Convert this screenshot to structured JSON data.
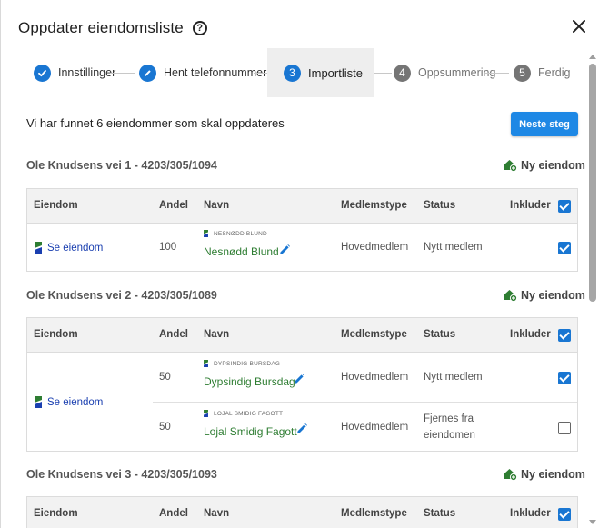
{
  "dialog": {
    "title": "Oppdater eiendomsliste",
    "help_icon": "help-circle-icon",
    "close_icon": "close-icon"
  },
  "stepper": {
    "steps": [
      {
        "number": "1",
        "label": "Innstillinger",
        "state": "done"
      },
      {
        "number": "2",
        "label": "Hent telefonnummer",
        "state": "done"
      },
      {
        "number": "3",
        "label": "Importliste",
        "state": "current"
      },
      {
        "number": "4",
        "label": "Oppsummering",
        "state": "todo"
      },
      {
        "number": "5",
        "label": "Ferdig",
        "state": "todo"
      }
    ]
  },
  "summary": "Vi har funnet 6 eiendommer som skal oppdateres",
  "next_button": "Neste steg",
  "new_property_label": "Ny eiendom",
  "columns": {
    "eiendom": "Eiendom",
    "andel": "Andel",
    "navn": "Navn",
    "medlemstype": "Medlemstype",
    "status": "Status",
    "inkluder": "Inkluder"
  },
  "sections": [
    {
      "title": "Ole Knudsens vei 1 - 4203/305/1094",
      "link": "Se eiendom",
      "header_checked": true,
      "rows": [
        {
          "andel": "100",
          "small_name": "NESNØDD BLUND",
          "name": "Nesnødd Blund",
          "medlemstype": "Hovedmedlem",
          "status": "Nytt medlem",
          "checked": true
        }
      ]
    },
    {
      "title": "Ole Knudsens vei 2 - 4203/305/1089",
      "link": "Se eiendom",
      "header_checked": true,
      "rows": [
        {
          "andel": "50",
          "small_name": "DYPSINDIG BURSDAG",
          "name": "Dypsindig Bursdag",
          "medlemstype": "Hovedmedlem",
          "status": "Nytt medlem",
          "checked": true
        },
        {
          "andel": "50",
          "small_name": "LOJAL SMIDIG FAGOTT",
          "name": "Lojal Smidig Fagott",
          "medlemstype": "Hovedmedlem",
          "status_line1": "Fjernes fra",
          "status_line2": "eiendomen",
          "checked": false
        }
      ]
    },
    {
      "title": "Ole Knudsens vei 3 - 4203/305/1093",
      "header_checked": true
    }
  ],
  "colors": {
    "primary": "#1976d2",
    "button": "#1e88e5",
    "name_green": "#2e7d32",
    "link_blue": "#1a3fb0",
    "house_green": "#2e7d32"
  }
}
